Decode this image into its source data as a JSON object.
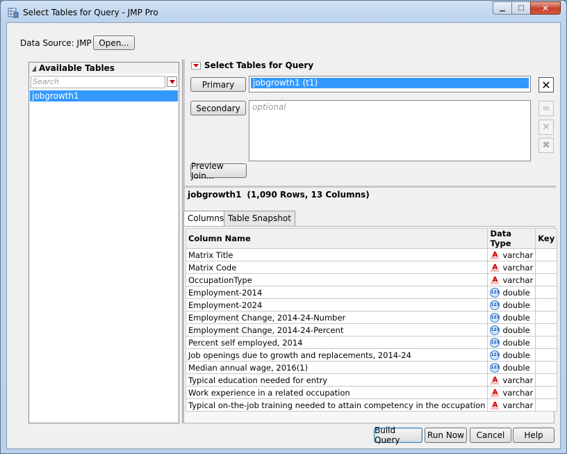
{
  "window": {
    "title": "Select Tables for Query - JMP Pro",
    "minimize": "▁",
    "maximize": "□",
    "close": "✕"
  },
  "data_source": {
    "label": "Data Source:  JMP",
    "open_button": "Open..."
  },
  "available": {
    "header": "Available Tables",
    "search_placeholder": "Search",
    "items": [
      "jobgrowth1"
    ]
  },
  "select": {
    "header": "Select Tables for Query",
    "primary_button": "Primary",
    "primary_value": "jobgrowth1 (t1)",
    "remove_icon": "✕",
    "secondary_button": "Secondary",
    "secondary_placeholder": "optional",
    "preview_join_button": "Preview Join...",
    "side_icons": [
      "link-icon",
      "remove-icon",
      "clear-icon"
    ]
  },
  "table_info": {
    "name": "jobgrowth1",
    "summary": "(1,090 Rows, 13 Columns)"
  },
  "tabs": [
    {
      "label": "Columns",
      "active": true
    },
    {
      "label": "Table Snapshot",
      "active": false
    }
  ],
  "columns_grid": {
    "headers": [
      "Column Name",
      "Data Type",
      "Key"
    ],
    "rows": [
      {
        "name": "Matrix Title",
        "type": "varchar",
        "icon": "char-icon"
      },
      {
        "name": "Matrix Code",
        "type": "varchar",
        "icon": "char-icon"
      },
      {
        "name": "OccupationType",
        "type": "varchar",
        "icon": "char-icon"
      },
      {
        "name": "Employment-2014",
        "type": "double",
        "icon": "numeric-icon"
      },
      {
        "name": "Employment-2024",
        "type": "double",
        "icon": "numeric-icon"
      },
      {
        "name": "Employment Change, 2014-24-Number",
        "type": "double",
        "icon": "numeric-icon"
      },
      {
        "name": "Employment Change, 2014-24-Percent",
        "type": "double",
        "icon": "numeric-icon"
      },
      {
        "name": "Percent self employed, 2014",
        "type": "double",
        "icon": "numeric-icon"
      },
      {
        "name": "Job openings due to growth and replacements, 2014-24",
        "type": "double",
        "icon": "numeric-icon"
      },
      {
        "name": "Median annual wage, 2016(1)",
        "type": "double",
        "icon": "numeric-icon"
      },
      {
        "name": "Typical education needed for entry",
        "type": "varchar",
        "icon": "char-icon"
      },
      {
        "name": "Work experience in a related occupation",
        "type": "varchar",
        "icon": "char-icon"
      },
      {
        "name": "Typical on-the-job training needed to attain competency in the occupation",
        "type": "varchar",
        "icon": "char-icon"
      }
    ]
  },
  "footer": {
    "build_query": "Build Query",
    "run_now": "Run Now",
    "cancel": "Cancel",
    "help": "Help"
  }
}
